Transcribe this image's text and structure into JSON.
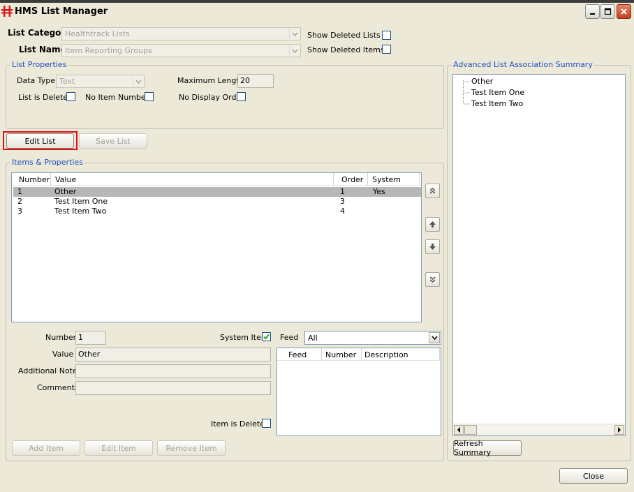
{
  "window": {
    "title": "HMS List Manager"
  },
  "header": {
    "list_category_label": "List Category",
    "list_category_value": "Healthtrack Lists",
    "list_name_label": "List Name",
    "list_name_value": "Item Reporting Groups",
    "show_deleted_lists_label": "Show Deleted Lists",
    "show_deleted_items_label": "Show Deleted Items"
  },
  "list_properties": {
    "group_label": "List Properties",
    "data_type_label": "Data Type",
    "data_type_value": "Text",
    "max_length_label": "Maximum Length",
    "max_length_value": "20",
    "list_is_deleted_label": "List is Deleted",
    "no_item_numbers_label": "No Item Numbers",
    "no_display_order_label": "No Display Order"
  },
  "actions": {
    "edit_list": "Edit List",
    "save_list": "Save List"
  },
  "items": {
    "group_label": "Items & Properties",
    "columns": [
      "Number",
      "Value",
      "Order",
      "System"
    ],
    "rows": [
      {
        "number": "1",
        "value": "Other",
        "order": "1",
        "system": "Yes"
      },
      {
        "number": "2",
        "value": "Test Item One",
        "order": "3",
        "system": ""
      },
      {
        "number": "3",
        "value": "Test Item Two",
        "order": "4",
        "system": ""
      }
    ]
  },
  "detail": {
    "number_label": "Number",
    "number_value": "1",
    "value_label": "Value",
    "value_value": "Other",
    "notes_label": "Additional Notes",
    "comments_label": "Comments",
    "system_item_label": "System Item",
    "feed_label": "Feed",
    "feed_value": "All",
    "feed_columns": [
      "Feed",
      "Number",
      "Description"
    ],
    "item_is_deleted_label": "Item is Deleted",
    "add_item": "Add Item",
    "edit_item": "Edit Item",
    "remove_item": "Remove Item"
  },
  "summary": {
    "group_label": "Advanced List Association Summary",
    "items": [
      "Other",
      "Test Item One",
      "Test Item Two"
    ],
    "refresh_button": "Refresh Summary"
  },
  "footer": {
    "close_button": "Close"
  },
  "colors": {
    "group_label": "#1e4ec0",
    "highlight_border": "#e01010",
    "selected_row": "#b7b7b7"
  }
}
